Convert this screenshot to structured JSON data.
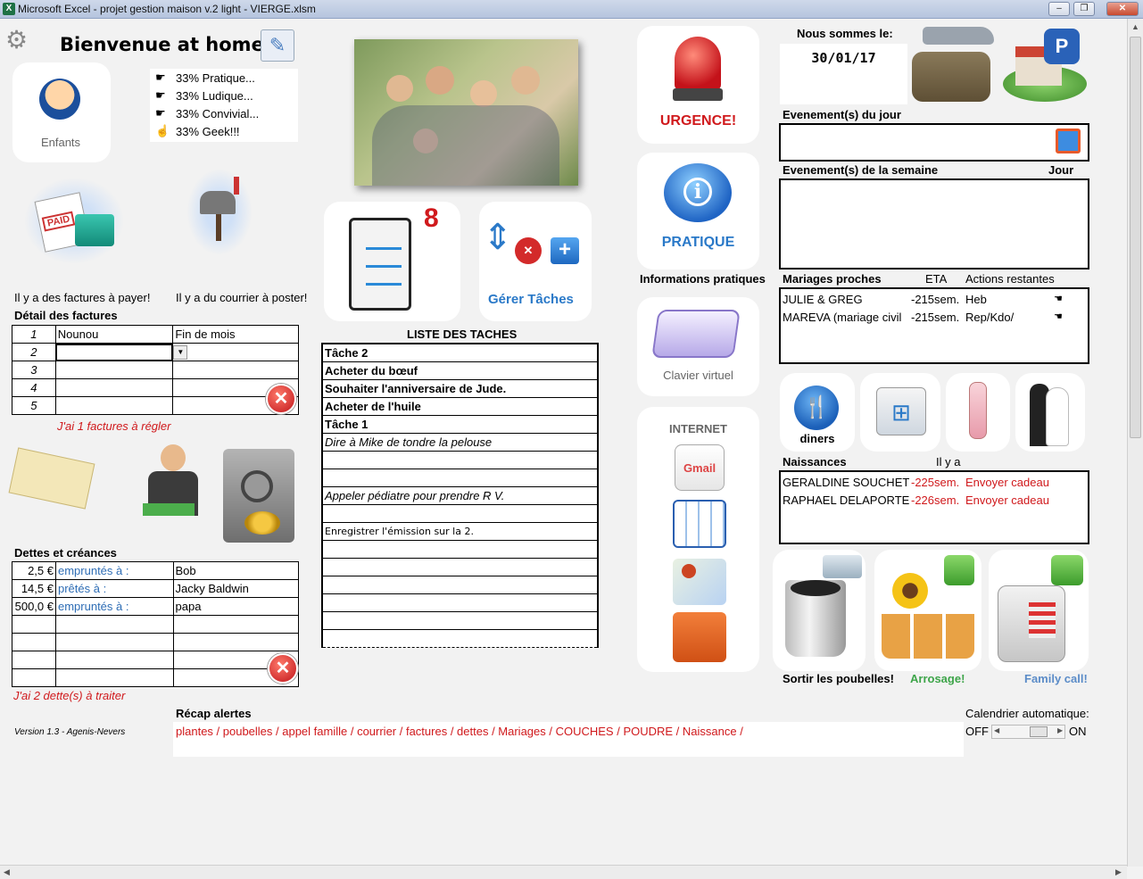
{
  "window": {
    "title": "Microsoft Excel - projet gestion maison v.2 light - VIERGE.xlsm",
    "app_icon": "X",
    "min": "–",
    "restore": "❐",
    "close": "✕"
  },
  "welcome": {
    "title": "Bienvenue at home!",
    "children_label": "Enfants",
    "tags": [
      "33% Pratique...",
      "33% Ludique...",
      "33% Convivial...",
      "33% Geek!!!"
    ]
  },
  "alerts": {
    "bills": "Il y a des factures à payer!",
    "mail": "Il y a du courrier à poster!"
  },
  "bills": {
    "header": "Détail des factures",
    "rows": [
      {
        "n": "1",
        "a": "Nounou",
        "b": "Fin de mois"
      },
      {
        "n": "2",
        "a": "",
        "b": ""
      },
      {
        "n": "3",
        "a": "",
        "b": ""
      },
      {
        "n": "4",
        "a": "",
        "b": ""
      },
      {
        "n": "5",
        "a": "",
        "b": ""
      }
    ],
    "summary": "J'ai 1 factures à régler"
  },
  "debts": {
    "header": "Dettes et créances",
    "rows": [
      {
        "amt": "2,5 €",
        "type": "empruntés à :",
        "who": "Bob"
      },
      {
        "amt": "14,5 €",
        "type": "prêtés à :",
        "who": "Jacky Baldwin"
      },
      {
        "amt": "500,0 €",
        "type": "empruntés à :",
        "who": "papa"
      },
      {
        "amt": "",
        "type": "",
        "who": ""
      },
      {
        "amt": "",
        "type": "",
        "who": ""
      },
      {
        "amt": "",
        "type": "",
        "who": ""
      },
      {
        "amt": "",
        "type": "",
        "who": ""
      }
    ],
    "summary": "J'ai 2 dette(s) à traiter"
  },
  "version": "Version 1.3 - Agenis-Nevers",
  "tasks": {
    "count": "8",
    "manage": "Gérer Tâches",
    "header": "LISTE DES TACHES",
    "rows": [
      "Tâche 2",
      "Acheter du bœuf",
      "Souhaiter l'anniversaire de Jude.",
      "Acheter de l'huile",
      "Tâche 1",
      "Dire à Mike de tondre la pelouse",
      "",
      "",
      "Appeler pédiatre pour prendre R V.",
      "",
      "Enregistrer l'émission sur la 2.",
      "",
      "",
      "",
      "",
      "",
      ""
    ]
  },
  "shortcuts": {
    "urgence": "URGENCE!",
    "pratique": "PRATIQUE",
    "infos": "Informations pratiques",
    "keyboard": "Clavier virtuel",
    "internet": "INTERNET",
    "gmail": "Gmail",
    "diners": "diners"
  },
  "date": {
    "label": "Nous sommes le:",
    "value": "30/01/17"
  },
  "events": {
    "day": "Evenement(s) du jour",
    "week": "Evenement(s) de la semaine",
    "jour": "Jour"
  },
  "weddings": {
    "header": "Mariages proches",
    "eta": "ETA",
    "actions": "Actions restantes",
    "rows": [
      {
        "name": "JULIE & GREG",
        "eta": "-215sem.",
        "action": "Heb"
      },
      {
        "name": "MAREVA (mariage civil",
        "eta": "-215sem.",
        "action": "Rep/Kdo/"
      }
    ]
  },
  "births": {
    "header": "Naissances",
    "ilya": "Il y a",
    "rows": [
      {
        "name": "GERALDINE SOUCHET",
        "eta": "-225sem.",
        "action": "Envoyer cadeau"
      },
      {
        "name": "RAPHAEL DELAPORTE",
        "eta": "-226sem.",
        "action": "Envoyer cadeau"
      }
    ]
  },
  "chores": {
    "trash": "Sortir les poubelles!",
    "water": "Arrosage!",
    "call": "Family call!"
  },
  "recap": {
    "label": "Récap alertes",
    "text": "plantes / poubelles / appel famille / courrier / factures / dettes / Mariages / COUCHES / POUDRE / Naissance /"
  },
  "calendar": {
    "label": "Calendrier automatique:",
    "off": "OFF",
    "on": "ON"
  }
}
